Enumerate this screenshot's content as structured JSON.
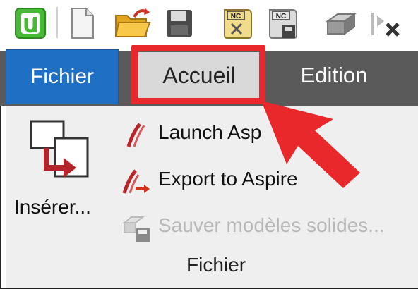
{
  "ribbon": {
    "tabs": {
      "file": "Fichier",
      "home": "Accueil",
      "edit": "Edition"
    },
    "home_panel": {
      "insert_label": "Insérer...",
      "launch_label": "Launch Asp",
      "export_label": "Export to Aspire",
      "save_solids_label": "Sauver modèles solides...",
      "group_label": "Fichier"
    }
  },
  "quick_access": {
    "icons": [
      "app-logo-icon",
      "new-document-icon",
      "open-folder-icon",
      "save-floppy-icon",
      "nc-program-icon",
      "nc-save-icon",
      "3d-solid-icon",
      "clear-axis-icon"
    ]
  },
  "annotation": {
    "highlight_color": "#e8282b"
  }
}
